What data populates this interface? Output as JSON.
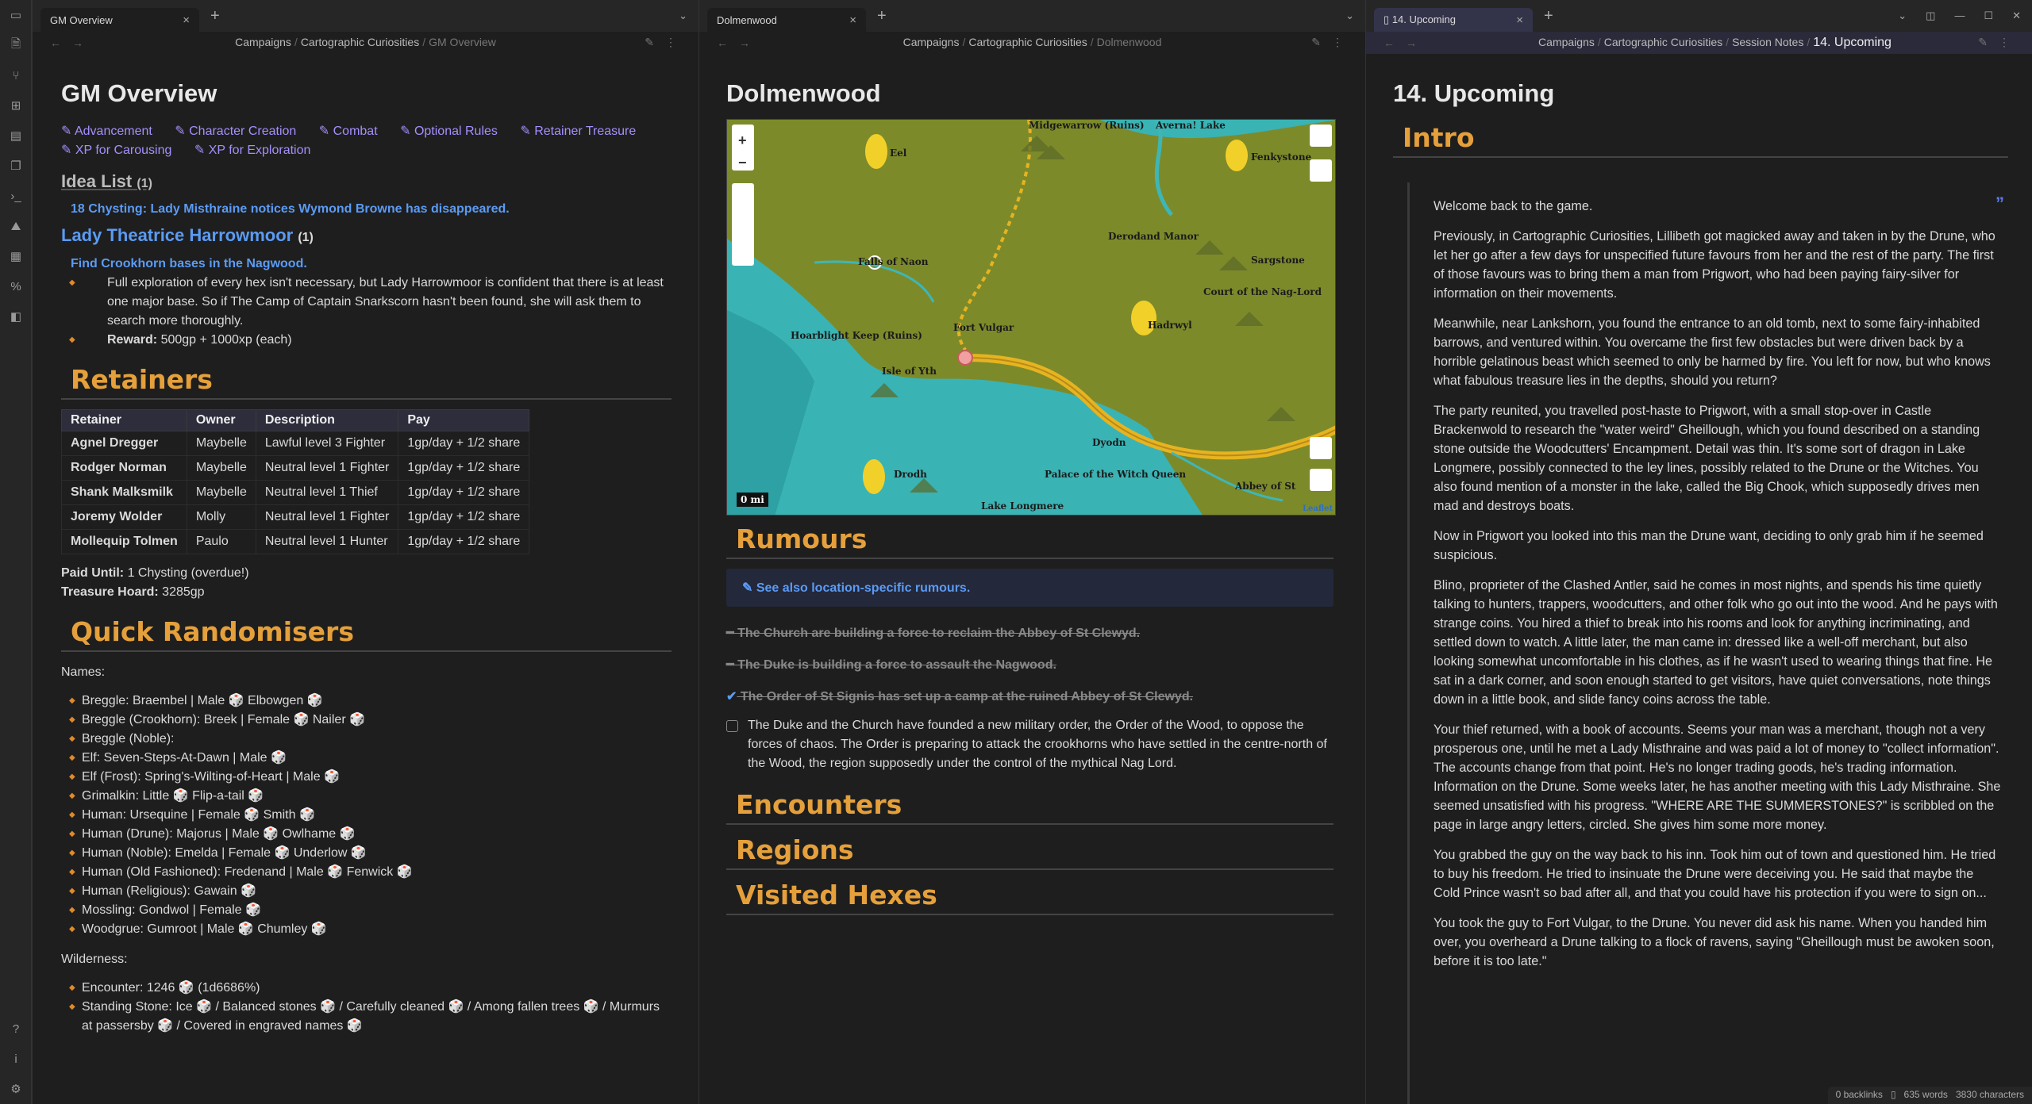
{
  "pane1": {
    "tab": "GM Overview",
    "crumbs": [
      "Campaigns",
      "Cartographic Curiosities",
      "GM Overview"
    ],
    "title": "GM Overview",
    "links": [
      "Advancement",
      "Character Creation",
      "Combat",
      "Optional Rules",
      "Retainer Treasure",
      "XP for Carousing",
      "XP for Exploration"
    ],
    "idea_heading": "Idea List",
    "idea_count": "(1)",
    "idea1": "18 Chysting: Lady Misthraine notices Wymond Browne has disappeared.",
    "lady_heading": "Lady Theatrice Harrowmoor",
    "lady_count": "(1)",
    "task": "Find Crookhorn bases in the Nagwood.",
    "task_detail": "Full exploration of every hex isn't necessary, but Lady Harrowmoor is confident that there is at least one major base. So if The Camp of Captain Snarkscorn hasn't been found, she will ask them to search more thoroughly.",
    "reward_label": "Reward:",
    "reward": "500gp + 1000xp (each)",
    "retainers_heading": "Retainers",
    "table_headers": [
      "Retainer",
      "Owner",
      "Description",
      "Pay"
    ],
    "table_rows": [
      [
        "Agnel Dregger",
        "Maybelle",
        "Lawful level 3 Fighter",
        "1gp/day + 1/2 share"
      ],
      [
        "Rodger Norman",
        "Maybelle",
        "Neutral level 1 Fighter",
        "1gp/day + 1/2 share"
      ],
      [
        "Shank Malksmilk",
        "Maybelle",
        "Neutral level 1 Thief",
        "1gp/day + 1/2 share"
      ],
      [
        "Joremy Wolder",
        "Molly",
        "Neutral level 1 Fighter",
        "1gp/day + 1/2 share"
      ],
      [
        "Mollequip Tolmen",
        "Paulo",
        "Neutral level 1 Hunter",
        "1gp/day + 1/2 share"
      ]
    ],
    "paid_label": "Paid Until:",
    "paid": "1 Chysting (overdue!)",
    "hoard_label": "Treasure Hoard:",
    "hoard": "3285gp",
    "rand_heading": "Quick Randomisers",
    "names_label": "Names:",
    "names": [
      "Breggle: Braembel | Male 🎲 Elbowgen 🎲",
      "Breggle (Crookhorn): Breek | Female 🎲 Nailer 🎲",
      "Breggle (Noble):",
      "Elf: Seven-Steps-At-Dawn | Male 🎲",
      "Elf (Frost): Spring's-Wilting-of-Heart | Male 🎲",
      "Grimalkin: Little 🎲 Flip-a-tail 🎲",
      "Human: Ursequine | Female 🎲 Smith 🎲",
      "Human (Drune): Majorus | Male 🎲 Owlhame 🎲",
      "Human (Noble): Emelda | Female 🎲 Underlow 🎲",
      "Human (Old Fashioned): Fredenand | Male 🎲 Fenwick 🎲",
      "Human (Religious): Gawain 🎲",
      "Mossling: Gondwol | Female 🎲",
      "Woodgrue: Gumroot | Male 🎲 Chumley 🎲"
    ],
    "wild_label": "Wilderness:",
    "wild": [
      "Encounter: 1246 🎲 (1d6686%)",
      "Standing Stone: Ice 🎲 / Balanced stones 🎲 / Carefully cleaned 🎲 / Among fallen trees 🎲 / Murmurs at passersby 🎲 / Covered in engraved names 🎲"
    ]
  },
  "pane2": {
    "tab": "Dolmenwood",
    "crumbs": [
      "Campaigns",
      "Cartographic Curiosities",
      "Dolmenwood"
    ],
    "title": "Dolmenwood",
    "map_labels": [
      "Midgewarrow (Ruins)",
      "Eel",
      "Averna! Lake",
      "Fenkystone",
      "Falls of Naon",
      "Derodand Manor",
      "Sargstone",
      "Court of the Nag-Lord",
      "Hoarblight Keep (Ruins)",
      "Fort Vulgar",
      "Hadrwyl",
      "Isle of Yth",
      "Palace of the Witch Queen",
      "Abbey of St",
      "Dyodn",
      "Lake Longmere",
      "Drodh",
      "0 mi",
      "Leaflet"
    ],
    "rumours_heading": "Rumours",
    "callout": "See also location-specific rumours.",
    "rumour_struck": [
      "The Church are building a force to reclaim the Abbey of St Clewyd.",
      "The Duke is building a force to assault the Nagwood.",
      "The Order of St Signis has set up a camp at the ruined Abbey of St Clewyd."
    ],
    "rumour_open": "The Duke and the Church have founded a new military order, the Order of the Wood, to oppose the forces of chaos. The Order is preparing to attack the crookhorns who have settled in the centre-north of the Wood, the region supposedly under the control of the mythical Nag Lord.",
    "folds": [
      "Encounters",
      "Regions",
      "Visited Hexes"
    ]
  },
  "pane3": {
    "tab": "14. Upcoming",
    "crumbs": [
      "Campaigns",
      "Cartographic Curiosities",
      "Session Notes",
      "14. Upcoming"
    ],
    "title": "14. Upcoming",
    "intro": "Intro",
    "paras": [
      "Welcome back to the game.",
      "Previously, in Cartographic Curiosities, Lillibeth got magicked away and taken in by the Drune, who let her go after a few days for unspecified future favours from her and the rest of the party. The first of those favours was to bring them a man from Prigwort, who had been paying fairy-silver for information on their movements.",
      "Meanwhile, near Lankshorn, you found the entrance to an old tomb, next to some fairy-inhabited barrows, and ventured within. You overcame the first few obstacles but were driven back by a horrible gelatinous beast which seemed to only be harmed by fire. You left for now, but who knows what fabulous treasure lies in the depths, should you return?",
      "The party reunited, you travelled post-haste to Prigwort, with a small stop-over in Castle Brackenwold to research the \"water weird\" Gheillough, which you found described on a standing stone outside the Woodcutters' Encampment. Detail was thin. It's some sort of dragon in Lake Longmere, possibly connected to the ley lines, possibly related to the Drune or the Witches. You also found mention of a monster in the lake, called the Big Chook, which supposedly drives men mad and destroys boats.",
      "Now in Prigwort you looked into this man the Drune want, deciding to only grab him if he seemed suspicious.",
      "Blino, proprieter of the Clashed Antler, said he comes in most nights, and spends his time quietly talking to hunters, trappers, woodcutters, and other folk who go out into the wood. And he pays with strange coins. You hired a thief to break into his rooms and look for anything incriminating, and settled down to watch. A little later, the man came in: dressed like a well-off merchant, but also looking somewhat uncomfortable in his clothes, as if he wasn't used to wearing things that fine. He sat in a dark corner, and soon enough started to get visitors, have quiet conversations, note things down in a little book, and slide fancy coins across the table.",
      "Your thief returned, with a book of accounts. Seems your man was a merchant, though not a very prosperous one, until he met a Lady Misthraine and was paid a lot of money to \"collect information\". The accounts change from that point. He's no longer trading goods, he's trading information. Information on the Drune. Some weeks later, he has another meeting with this Lady Misthraine. She seemed unsatisfied with his progress. \"WHERE ARE THE SUMMERSTONES?\" is scribbled on the page in large angry letters, circled. She gives him some more money.",
      "You grabbed the guy on the way back to his inn. Took him out of town and questioned him. He tried to buy his freedom. He tried to insinuate the Drune were deceiving you. He said that maybe the Cold Prince wasn't so bad after all, and that you could have his protection if you were to sign on...",
      "You took the guy to Fort Vulgar, to the Drune. You never did ask his name. When you handed him over, you overheard a Drune talking to a flock of ravens, saying \"Gheillough must be awoken soon, before it is too late.\""
    ],
    "status": [
      "0 backlinks",
      "635 words",
      "3830 characters"
    ]
  }
}
